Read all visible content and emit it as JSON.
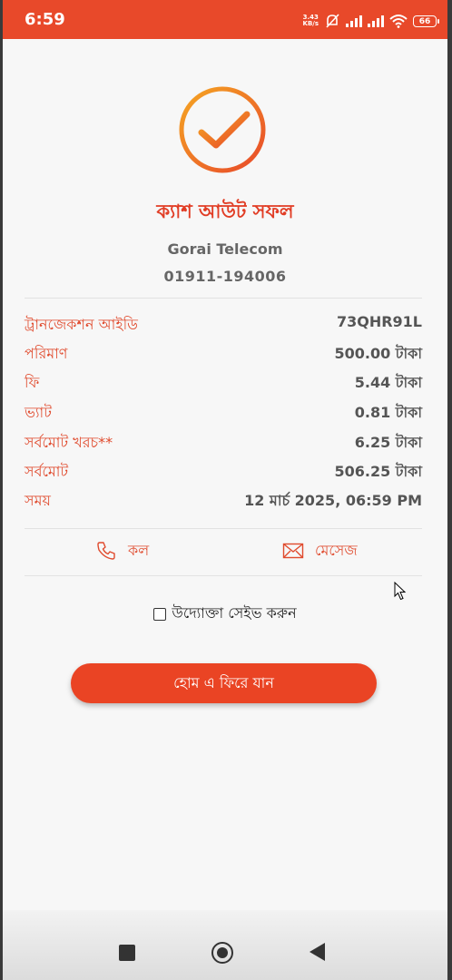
{
  "status_bar": {
    "time": "6:59",
    "net_speed_value": "3.43",
    "net_speed_unit": "KB/s",
    "battery": "66"
  },
  "receipt": {
    "title": "ক্যাশ আউট সফল",
    "merchant_name": "Gorai Telecom",
    "merchant_number": "01911-194006",
    "rows": [
      {
        "label": "ট্রানজেকশন আইডি",
        "value": "73QHR91L"
      },
      {
        "label": "পরিমাণ",
        "value": "500.00 টাকা"
      },
      {
        "label": "ফি",
        "value": "5.44 টাকা"
      },
      {
        "label": "ভ্যাট",
        "value": "0.81 টাকা"
      },
      {
        "label": "সর্বমোট খরচ**",
        "value": "6.25 টাকা"
      },
      {
        "label": "সর্বমোট",
        "value": "506.25 টাকা"
      },
      {
        "label": "সময়",
        "value": "12 মার্চ 2025, 06:59 PM"
      }
    ]
  },
  "actions": {
    "call_label": "কল",
    "message_label": "মেসেজ"
  },
  "save_merchant_label": "উদ্যোক্তা সেইভ করুন",
  "home_button_label": "হোম এ ফিরে যান",
  "colors": {
    "accent": "#e8492a",
    "label_red": "#e04a2d"
  }
}
